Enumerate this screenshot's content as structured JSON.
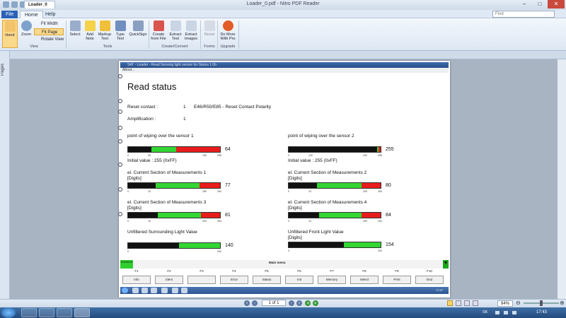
{
  "window": {
    "title": "Loader_0.pdf - Nitro PDF Reader",
    "min": "‒",
    "max": "□",
    "close": "✕"
  },
  "menu": {
    "file": "File",
    "home": "Home",
    "help": "Help"
  },
  "search": {
    "placeholder": "Find"
  },
  "ribbon": {
    "hand": "Hand",
    "zoom": "Zoom",
    "fit_width": "Fit Width",
    "fit_page": "Fit Page",
    "rotate_view": "Rotate View",
    "select": "Select",
    "add_note": "Add Note",
    "markup_text": "Markup Text",
    "type_text": "Type Text",
    "quicksign": "QuickSign",
    "create_from_file": "Create from File",
    "extract_text": "Extract Text",
    "extract_images": "Extract Images",
    "reset": "Reset",
    "do_more": "Do More With Pro",
    "groups": {
      "view": "View",
      "tools": "Tools",
      "create_convert": "Create/Convert",
      "forms": "Forms",
      "upgrade": "Upgrade"
    }
  },
  "left_panel": {
    "pages": "Pages"
  },
  "doc_tab": {
    "label": "Loader_0"
  },
  "inner": {
    "title": "SAT - Loader - Read Sensing light sensor for Status 1.0b",
    "menu": "About..."
  },
  "content": {
    "heading": "Read status",
    "reset_label": "Reset contact :",
    "reset_value": "1",
    "reset_desc": "E46/R50/E85 - Reset Contact Polarity",
    "amp_label": "Amplification :",
    "amp_value": "1",
    "sections": [
      {
        "label": "point of wiping over the sensor 1",
        "value": "64",
        "ticks": [
          "0",
          "30",
          "130",
          "255"
        ],
        "extra": "Initial value : 255 (0xFF)",
        "black": 0.25,
        "green": 0.27
      },
      {
        "label": "point of wiping over the sensor 2",
        "value": "255",
        "ticks": [
          "0",
          "120",
          "240",
          "255"
        ],
        "extra": "Initial value : 255 (0xFF)",
        "black": 0.96,
        "green": 0.02
      },
      {
        "label": "el. Current Section of Measurements 1",
        "unit": "[Digits]",
        "value": "77",
        "ticks": [
          "0",
          "15",
          "180",
          "254"
        ],
        "black": 0.3,
        "green": 0.48
      },
      {
        "label": "el. Current Section of Measurements 2",
        "unit": "[Digits]",
        "value": "80",
        "ticks": [
          "0",
          "10",
          "200",
          "254"
        ],
        "black": 0.31,
        "green": 0.48
      },
      {
        "label": "el. Current Section of Measurements 3",
        "unit": "[Digits]",
        "value": "81",
        "ticks": [
          "0",
          "15",
          "200",
          "254"
        ],
        "black": 0.32,
        "green": 0.47
      },
      {
        "label": "el. Current Section of Measurements 4",
        "unit": "[Digits]",
        "value": "84",
        "ticks": [
          "0",
          "10",
          "200",
          "254"
        ],
        "black": 0.33,
        "green": 0.46
      },
      {
        "label": "Unfiltered Surrounding Light Value",
        "value": "140",
        "ticks": [
          "0",
          "",
          "",
          "200"
        ],
        "black": 0.55,
        "green": 0.45
      },
      {
        "label": "Unfiltered Front Light Value",
        "unit": "[Digits]",
        "value": "154",
        "ticks": [
          "0",
          "",
          "",
          "200"
        ],
        "black": 0.6,
        "green": 0.4
      }
    ]
  },
  "status": {
    "running": "RUNNING",
    "main_menu": "Main menu",
    "down": "▼"
  },
  "fkeys": {
    "keys": [
      "F1",
      "F2",
      "F3",
      "F4",
      "F5",
      "F6",
      "F7",
      "F8",
      "F9",
      "F10"
    ],
    "labels": [
      "Info",
      "Ident",
      "",
      "Error",
      "Status",
      "Init",
      "Memory",
      "Select",
      "Print",
      "End"
    ]
  },
  "inner_clock": "17:47",
  "statusbar": {
    "page": "1 of 1",
    "zoom": "84%"
  },
  "taskbar": {
    "lang": "SK",
    "clock": "17:43"
  }
}
